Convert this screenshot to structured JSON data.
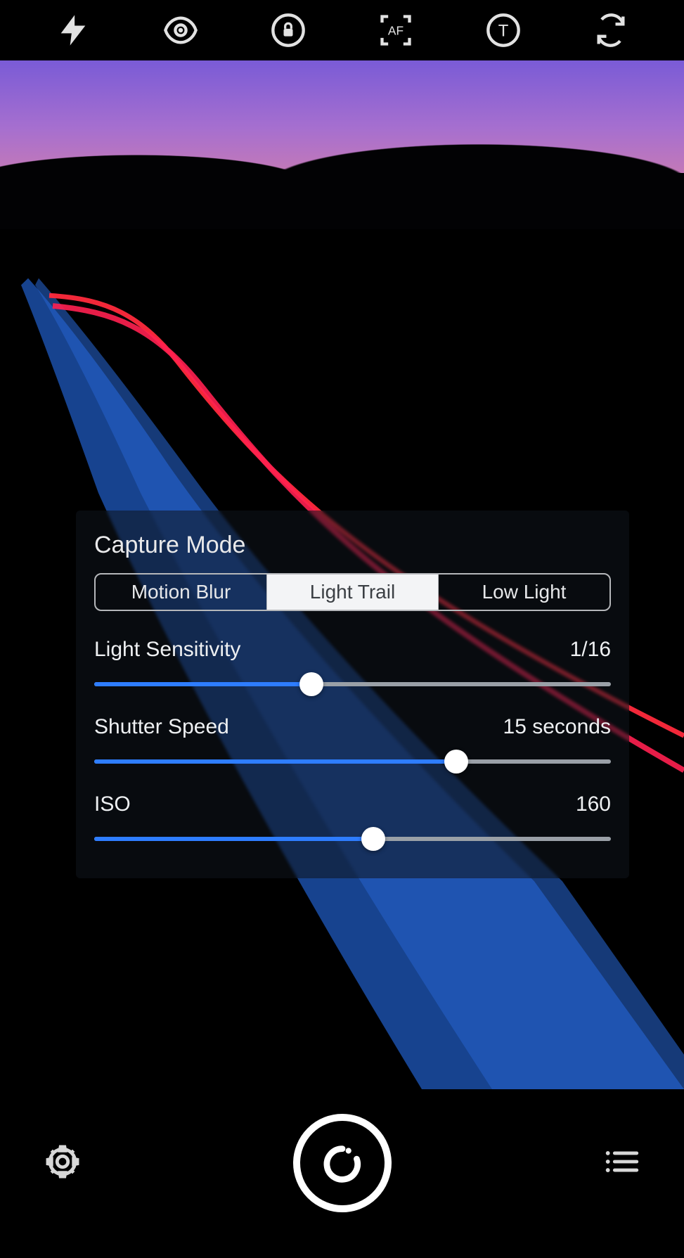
{
  "toolbar": {
    "flash_icon": "flash-icon",
    "preview_icon": "eye-icon",
    "lock_icon": "lock-icon",
    "af_label": "AF",
    "timer_label": "T",
    "switch_icon": "switch-camera-icon"
  },
  "panel": {
    "title": "Capture Mode",
    "modes": [
      {
        "label": "Motion Blur",
        "active": false
      },
      {
        "label": "Light Trail",
        "active": true
      },
      {
        "label": "Low Light",
        "active": false
      }
    ],
    "sliders": [
      {
        "label": "Light Sensitivity",
        "value": "1/16",
        "percent": 42
      },
      {
        "label": "Shutter Speed",
        "value": "15 seconds",
        "percent": 70
      },
      {
        "label": "ISO",
        "value": "160",
        "percent": 54
      }
    ]
  },
  "bottom": {
    "settings_icon": "gear-icon",
    "shutter_icon": "timer-shutter-icon",
    "menu_icon": "list-icon"
  }
}
